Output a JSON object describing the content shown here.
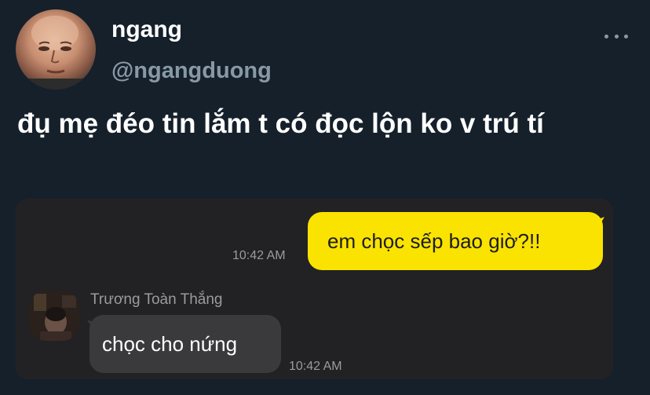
{
  "tweet": {
    "author": {
      "name": "ngang",
      "handle": "@ngangduong",
      "avatar_icon": "profile-photo"
    },
    "more_icon": "more-options-icon",
    "text": "đụ mẹ đéo tin lắm t có đọc lộn ko v trú tí"
  },
  "chat_screenshot": {
    "outgoing": {
      "message": "em chọc sếp bao giờ?!!",
      "time": "10:42 AM",
      "bubble_color": "#fae300"
    },
    "incoming": {
      "sender": "Trương Toàn Thắng",
      "message": "chọc cho nứng",
      "time": "10:42 AM",
      "bubble_color": "#3a3a3d"
    },
    "background_color": "#222225"
  },
  "colors": {
    "page_background": "#15202b",
    "handle_text": "#8899a6"
  }
}
